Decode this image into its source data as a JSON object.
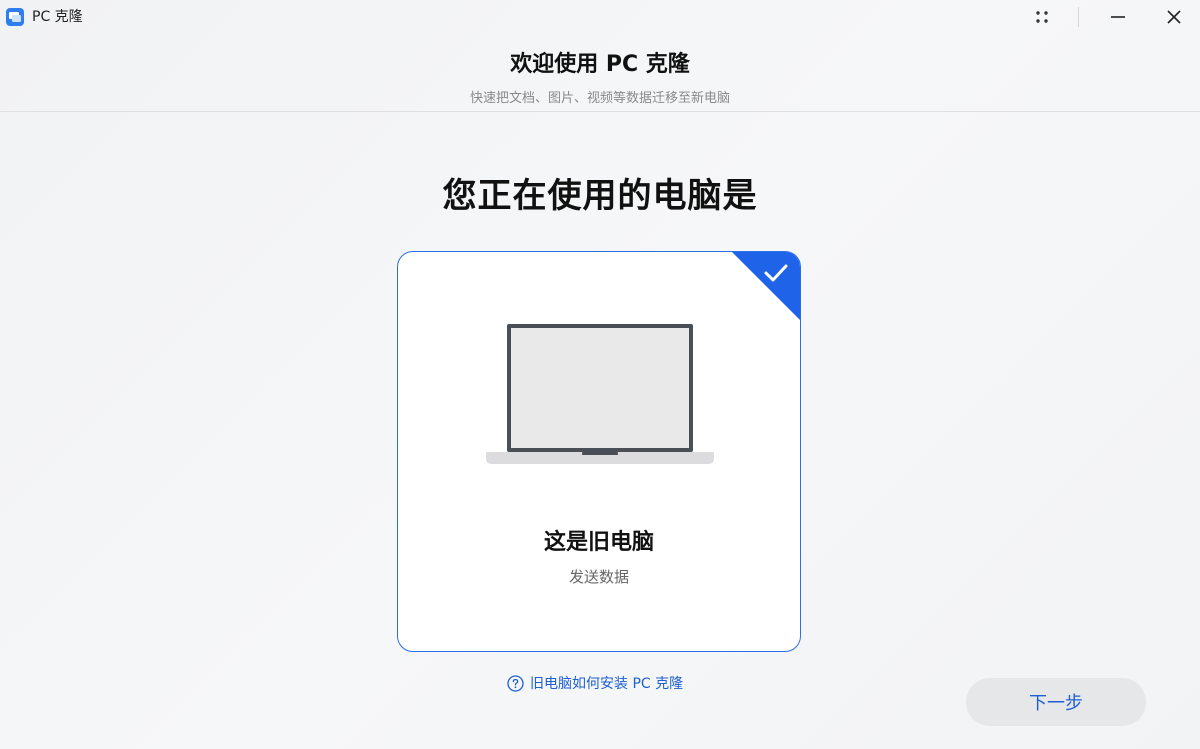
{
  "window": {
    "app_title": "PC 克隆"
  },
  "header": {
    "title": "欢迎使用 PC 克隆",
    "subtitle": "快速把文档、图片、视频等数据迁移至新电脑"
  },
  "main": {
    "question": "您正在使用的电脑是",
    "card": {
      "title": "这是旧电脑",
      "subtitle": "发送数据",
      "selected": true
    },
    "help_link": "旧电脑如何安装 PC 克隆",
    "next_button": "下一步"
  },
  "colors": {
    "accent": "#1f5fd1",
    "card_border": "#2a6fe6",
    "button_bg": "#e6e7e9"
  },
  "icons": {
    "app": "pc-clone-app-icon",
    "more": "grid-dots-icon",
    "minimize": "minimize-icon",
    "close": "close-icon",
    "check": "check-icon",
    "help": "question-circle-icon",
    "device": "laptop-icon"
  }
}
